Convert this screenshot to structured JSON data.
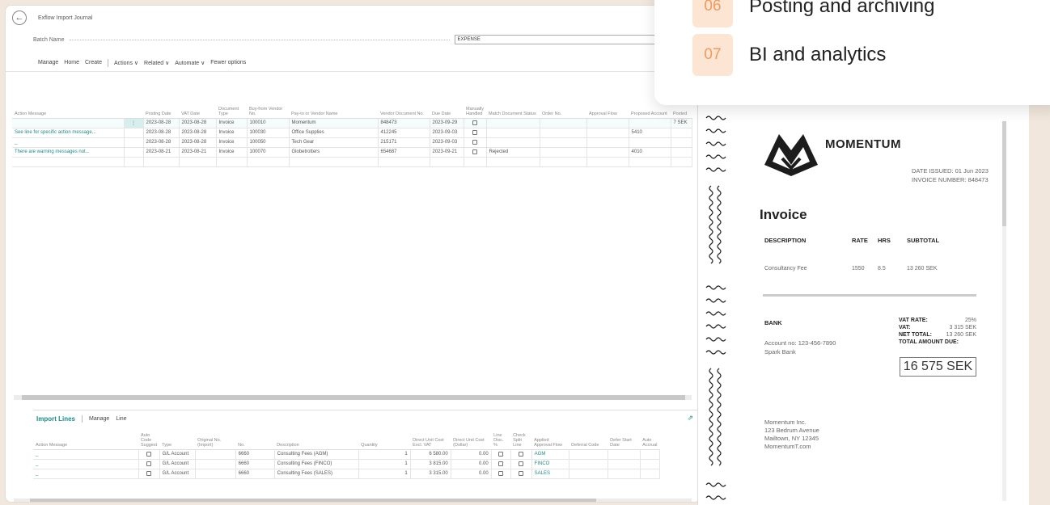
{
  "app": {
    "page_title": "Exflow Import Journal",
    "batch_label": "Batch Name",
    "batch_value": "EXPENSE",
    "actions": [
      "Manage",
      "Home",
      "Create",
      "Actions ∨",
      "Related ∨",
      "Automate ∨",
      "Fewer options"
    ]
  },
  "journal": {
    "columns": [
      "Action Message",
      "",
      "Posting Date",
      "VAT Date",
      "Document Type",
      "Buy-from Vendor No.",
      "Pay-to or Vendor Name",
      "Vendor Document No.",
      "Due Date",
      "Manually Handled",
      "Match Document Status",
      "Order No.",
      "Approval Flow",
      "Proposed Account",
      "Posted"
    ],
    "rows": [
      {
        "msg": "",
        "pd": "2023-08-28",
        "vd": "2023-08-28",
        "type": "Invoice",
        "vno": "100010",
        "vname": "Momentum",
        "doc": "848473",
        "due": "2023-09-29",
        "match": "",
        "order": "",
        "flow": "",
        "acct": "",
        "posted": "7 SEK",
        "selected": true
      },
      {
        "msg": "See line for specific action message...",
        "pd": "2023-08-28",
        "vd": "2023-08-28",
        "type": "Invoice",
        "vno": "100030",
        "vname": "Office Supplies",
        "doc": "412245",
        "due": "2023-09-03",
        "match": "",
        "order": "",
        "flow": "",
        "acct": "5410",
        "posted": ""
      },
      {
        "msg": "_",
        "pd": "2023-08-28",
        "vd": "2023-08-28",
        "type": "Invoice",
        "vno": "100050",
        "vname": "Tech Gear",
        "doc": "215171",
        "due": "2023-09-03",
        "match": "",
        "order": "",
        "flow": "",
        "acct": "",
        "posted": ""
      },
      {
        "msg": "There are warning messages not...",
        "pd": "2023-08-21",
        "vd": "2023-08-21",
        "type": "Invoice",
        "vno": "100070",
        "vname": "Globetrotters",
        "doc": "654687",
        "due": "2023-09-21",
        "match": "Rejected",
        "order": "",
        "flow": "",
        "acct": "4010",
        "posted": ""
      }
    ]
  },
  "import_lines": {
    "title": "Import Lines",
    "actions": [
      "Manage",
      "Line"
    ],
    "columns": [
      "Action Message",
      "Auto Code Suggest",
      "Type",
      "Original No. (Import)",
      "No.",
      "Description",
      "Quantity",
      "Direct Unit Cost Excl. VAT",
      "Direct Unit Cost (Dollar)",
      "Line Disc. %",
      "Check Split Line",
      "Applied Approval Flow",
      "Deferral Code",
      "Defer Start Date",
      "Auto Accrual"
    ],
    "rows": [
      {
        "msg": "_",
        "type": "G/L Account",
        "orig": "",
        "no": "6660",
        "desc": "Consulting Fees (AGM)",
        "qty": "1",
        "cost": "6 580.00",
        "costd": "0.00",
        "flow": "AGM"
      },
      {
        "msg": "_",
        "type": "G/L Account",
        "orig": "",
        "no": "6660",
        "desc": "Consulting Fees (FINCO)",
        "qty": "1",
        "cost": "3 815.00",
        "costd": "0.00",
        "flow": "FINCO"
      },
      {
        "msg": "_",
        "type": "G/L Account",
        "orig": "",
        "no": "6660",
        "desc": "Consulting Fees (SALES)",
        "qty": "1",
        "cost": "3 315.00",
        "costd": "0.00",
        "flow": "SALES"
      }
    ]
  },
  "invoice": {
    "brand": "MOMENTUM",
    "date_issued": "DATE ISSUED: 01 Jun 2023",
    "invoice_number": "INVOICE NUMBER: 848473",
    "title": "Invoice",
    "headers": [
      "DESCRIPTION",
      "RATE",
      "HRS",
      "SUBTOTAL"
    ],
    "line": {
      "desc": "Consultancy Fee",
      "rate": "1550",
      "hrs": "8.5",
      "subtotal": "13 260 SEK"
    },
    "bank_label": "BANK",
    "account": "Account no: 123-456-7890",
    "bank_name": "Spark Bank",
    "vat_rate_label": "VAT RATE:",
    "vat_rate": "25%",
    "vat_label": "VAT:",
    "vat": "3 315 SEK",
    "net_label": "NET TOTAL:",
    "net": "13 260 SEK",
    "total_label": "TOTAL AMOUNT DUE:",
    "total": "16 575 SEK",
    "address": [
      "Momentum Inc.",
      "123 Bedrum Avenue",
      "Mailtown, NY 12345",
      "MomentumT.com"
    ]
  },
  "card": {
    "steps": [
      {
        "num": "06",
        "label": "Posting and archiving"
      },
      {
        "num": "07",
        "label": "BI and analytics"
      }
    ]
  }
}
